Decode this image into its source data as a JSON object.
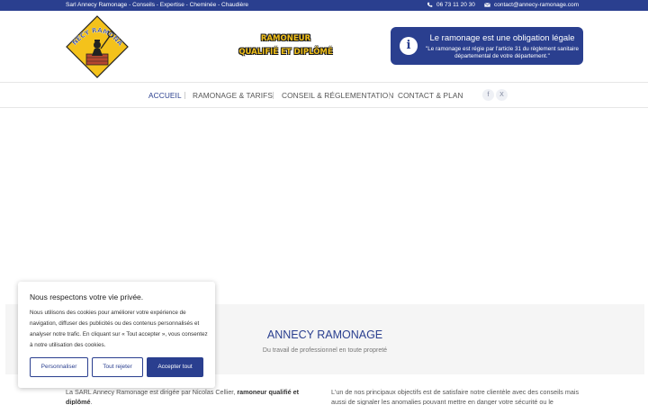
{
  "topbar": {
    "tagline": "Sarl Annecy Ramonage - Conseils - Expertise - Cheminée - Chaudière",
    "phone": "06 73 11 20 30",
    "email": "contact@annecy-ramonage.com"
  },
  "header": {
    "logo_text": "ANNECY RAMONAGE",
    "slogan_line1": "RAMONEUR",
    "slogan_line2": "QUALIFIÉ ET DIPLÔMÉ",
    "legal_title": "Le ramonage est une obligation légale",
    "legal_desc": "\"Le ramonage est régie par l'article 31 du règlement sanitaire départemental de votre département.\"",
    "info_glyph": "i"
  },
  "nav": {
    "items": [
      "ACCUEIL",
      "RAMONAGE & TARIFS",
      "CONSEIL & RÉGLEMENTATION",
      "CONTACT & PLAN"
    ],
    "social": [
      "f",
      "X"
    ]
  },
  "intro": {
    "title": "ANNECY RAMONAGE",
    "subtitle": "Du travail de professionnel en toute propreté",
    "left_prefix": "La SARL Annecy Ramonage est dirigée par Nicolas Cellier, ",
    "left_bold": "ramoneur qualifié et diplômé",
    "left_suffix": ".",
    "right_text": "L'un de nos principaux objectifs est de satisfaire notre clientèle avec des conseils mais aussi de signaler les anomalies pouvant mettre en danger votre sécurité ou le"
  },
  "cookie": {
    "title": "Nous respectons votre vie privée.",
    "text": "Nous utilisons des cookies pour améliorer votre expérience de navigation, diffuser des publicités ou des contenus personnalisés et analyser notre trafic. En cliquant sur « Tout accepter », vous consentez à notre utilisation des cookies.",
    "customize": "Personnaliser",
    "reject": "Tout rejeter",
    "accept": "Accepter tout"
  },
  "colors": {
    "brand_blue": "#2a3f8f",
    "logo_yellow": "#f4c21b"
  }
}
